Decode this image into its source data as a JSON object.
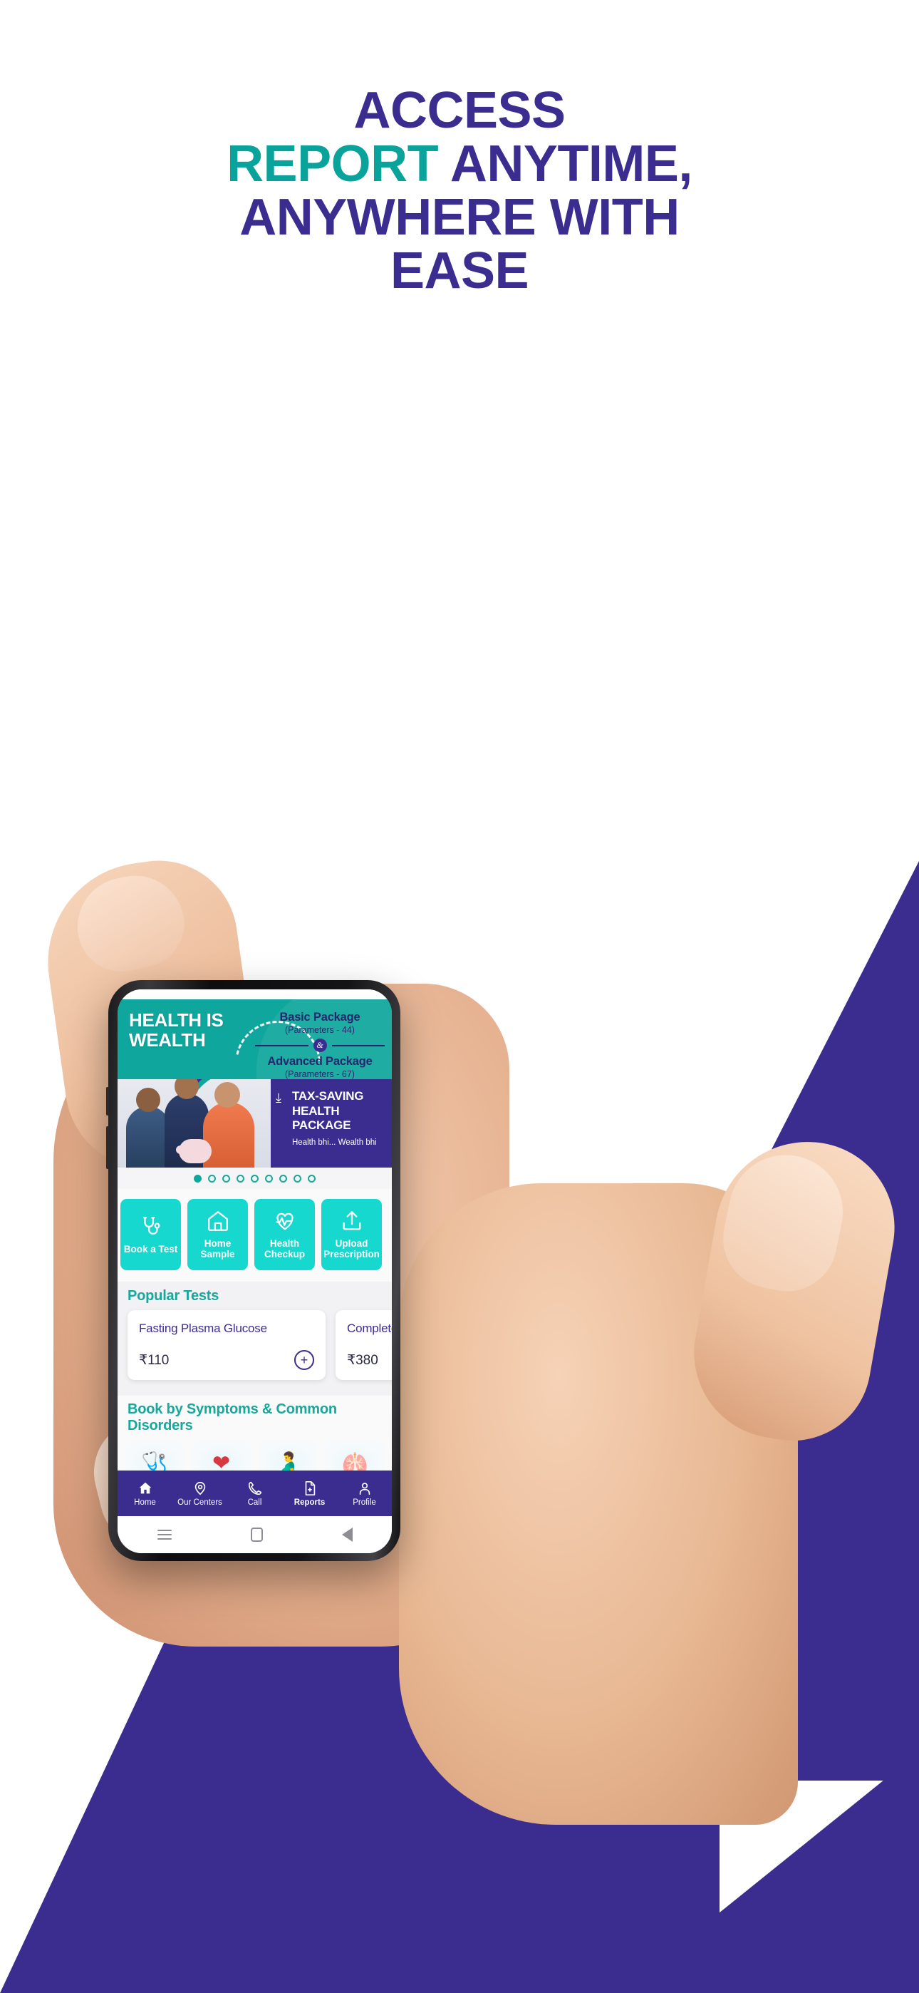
{
  "poster": {
    "headline_lines": [
      {
        "parts": [
          {
            "text": "ACCESS",
            "color": "purple"
          }
        ]
      },
      {
        "parts": [
          {
            "text": "REPORT",
            "color": "teal"
          },
          {
            "text": " ANYTIME,",
            "color": "purple"
          }
        ]
      },
      {
        "parts": [
          {
            "text": "ANYWHERE WITH",
            "color": "purple"
          }
        ]
      },
      {
        "parts": [
          {
            "text": "EASE",
            "color": "purple"
          }
        ]
      }
    ],
    "headline_text": "ACCESS REPORT ANYTIME, ANYWHERE WITH EASE",
    "colors": {
      "purple": "#3B2D8F",
      "teal": "#0AA39C",
      "app_teal": "#0FA79D",
      "tile_teal": "#16D8CE",
      "white": "#FFFFFF"
    }
  },
  "app": {
    "banner": {
      "title_line1": "HEALTH IS",
      "title_line2": "WEALTH",
      "basic_package": {
        "name": "Basic Package",
        "sub": "(Parameters - 44)"
      },
      "connector": "&",
      "advanced_package": {
        "name": "Advanced Package",
        "sub": "(Parameters - 67)"
      },
      "tax_line1": "TAX-SAVING",
      "tax_line2": "HEALTH PACKAGE",
      "tax_tagline": "Health bhi... Wealth bhi",
      "carousel_total": 9,
      "carousel_active": 1
    },
    "quick_actions": [
      {
        "label_line1": "Book a Test",
        "label_line2": "",
        "icon": "stethoscope-icon"
      },
      {
        "label_line1": "Home",
        "label_line2": "Sample",
        "icon": "home-sample-icon"
      },
      {
        "label_line1": "Health",
        "label_line2": "Checkup",
        "icon": "heart-pulse-icon"
      },
      {
        "label_line1": "Upload",
        "label_line2": "Prescription",
        "icon": "upload-icon"
      }
    ],
    "popular_tests": {
      "section_title": "Popular Tests",
      "items": [
        {
          "name": "Fasting Plasma Glucose",
          "price": "₹110",
          "add_label": "+"
        },
        {
          "name": "Complete Blood Count",
          "price": "₹380",
          "add_label": "+"
        }
      ]
    },
    "symptoms": {
      "section_title": "Book by Symptoms & Common Disorders",
      "items": [
        {
          "name": "diabetes-icon",
          "glyph": "🩺"
        },
        {
          "name": "heart-icon",
          "glyph": "❤"
        },
        {
          "name": "pregnancy-icon",
          "glyph": "🫃"
        },
        {
          "name": "kidney-icon",
          "glyph": "🫁"
        }
      ]
    },
    "bottom_nav": [
      {
        "label": "Home",
        "icon": "home-icon",
        "active": false
      },
      {
        "label": "Our Centers",
        "icon": "location-pin-icon",
        "active": false
      },
      {
        "label": "Call",
        "icon": "phone-icon",
        "active": false
      },
      {
        "label": "Reports",
        "icon": "document-plus-icon",
        "active": true
      },
      {
        "label": "Profile",
        "icon": "person-icon",
        "active": false
      }
    ],
    "android_nav": [
      {
        "name": "recents-button",
        "icon": "menu-lines-icon"
      },
      {
        "name": "home-button",
        "icon": "square-icon"
      },
      {
        "name": "back-button",
        "icon": "triangle-left-icon"
      }
    ]
  }
}
